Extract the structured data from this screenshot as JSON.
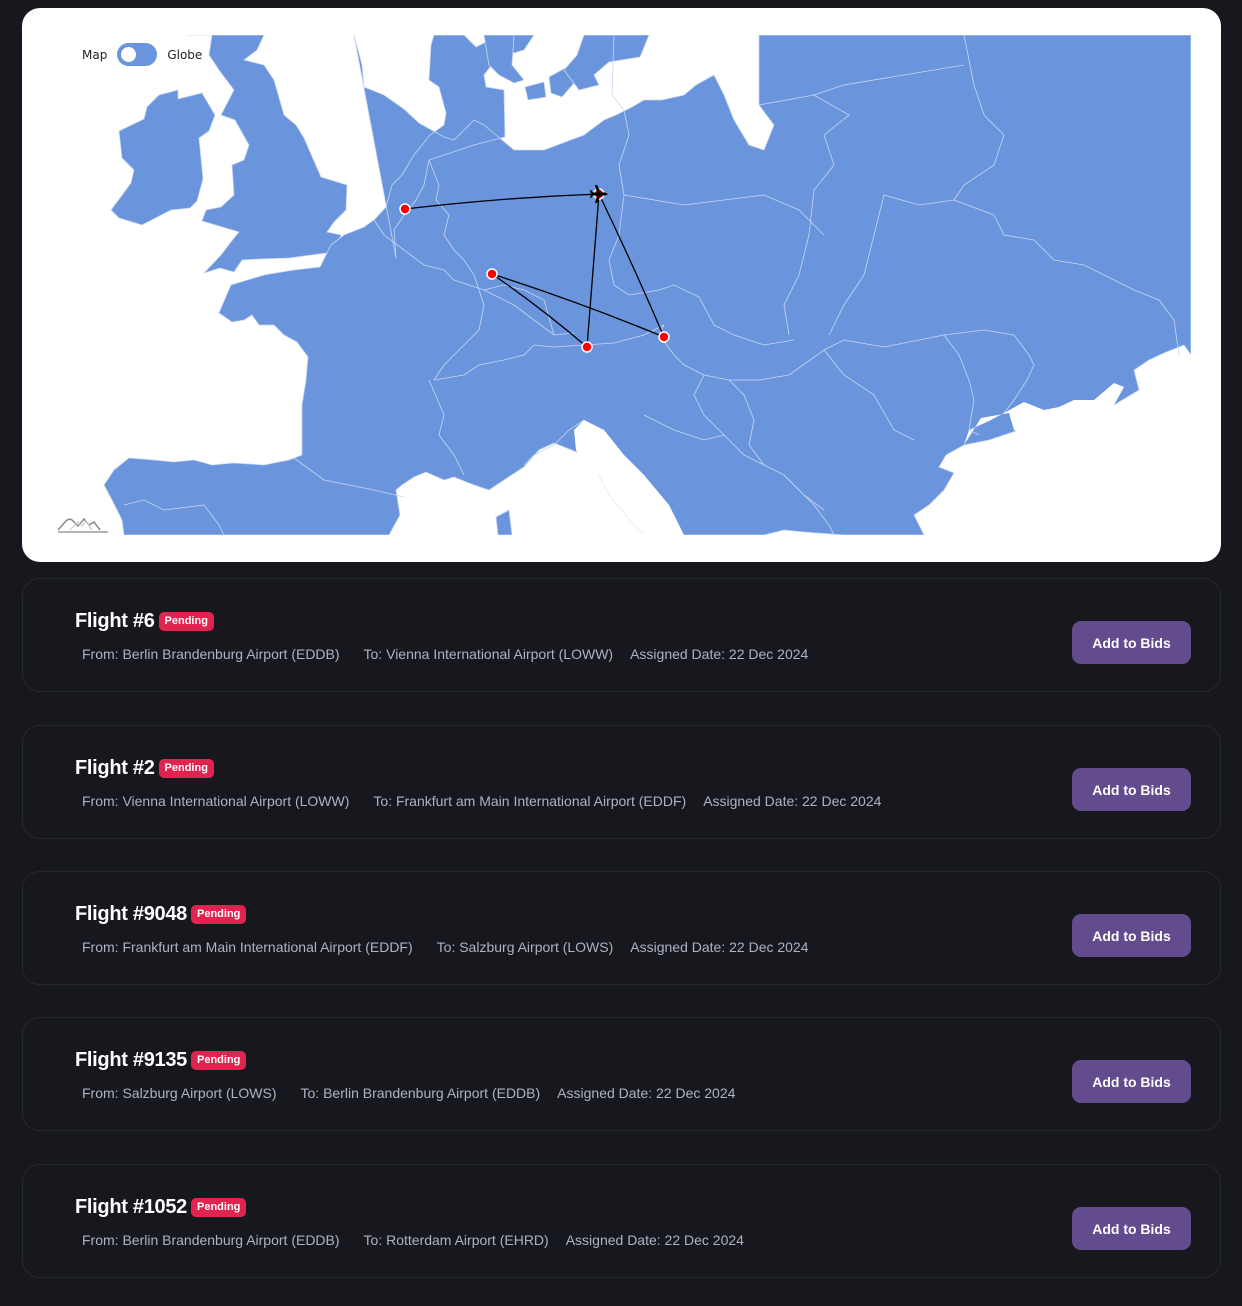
{
  "map": {
    "toggle_left_label": "Map",
    "toggle_right_label": "Globe",
    "toggle_state": "Map",
    "land_color": "#6a95dc",
    "border_color": "#c8d6f2",
    "route_color": "#000000",
    "airport_marker_color": "#ff0000",
    "airports": [
      {
        "code": "EDDB",
        "name": "Berlin Brandenburg Airport"
      },
      {
        "code": "EHRD",
        "name": "Rotterdam Airport"
      },
      {
        "code": "EDDF",
        "name": "Frankfurt am Main International Airport"
      },
      {
        "code": "LOWS",
        "name": "Salzburg Airport"
      },
      {
        "code": "LOWW",
        "name": "Vienna International Airport"
      }
    ],
    "routes": [
      [
        "EDDB",
        "LOWW"
      ],
      [
        "LOWW",
        "EDDF"
      ],
      [
        "EDDF",
        "LOWS"
      ],
      [
        "LOWS",
        "EDDB"
      ],
      [
        "EDDB",
        "EHRD"
      ]
    ],
    "aircraft_at": "EDDB"
  },
  "flights": [
    {
      "title": "Flight #6",
      "status": "Pending",
      "from": "From: Berlin Brandenburg Airport (EDDB)",
      "to": "To: Vienna International Airport (LOWW)",
      "assigned": "Assigned Date: 22 Dec 2024",
      "button": "Add to Bids"
    },
    {
      "title": "Flight #2",
      "status": "Pending",
      "from": "From: Vienna International Airport (LOWW)",
      "to": "To: Frankfurt am Main International Airport (EDDF)",
      "assigned": "Assigned Date: 22 Dec 2024",
      "button": "Add to Bids"
    },
    {
      "title": "Flight #9048",
      "status": "Pending",
      "from": "From: Frankfurt am Main International Airport (EDDF)",
      "to": "To: Salzburg Airport (LOWS)",
      "assigned": "Assigned Date: 22 Dec 2024",
      "button": "Add to Bids"
    },
    {
      "title": "Flight #9135",
      "status": "Pending",
      "from": "From: Salzburg Airport (LOWS)",
      "to": "To: Berlin Brandenburg Airport (EDDB)",
      "assigned": "Assigned Date: 22 Dec 2024",
      "button": "Add to Bids"
    },
    {
      "title": "Flight #1052",
      "status": "Pending",
      "from": "From: Berlin Brandenburg Airport (EDDB)",
      "to": "To: Rotterdam Airport (EHRD)",
      "assigned": "Assigned Date: 22 Dec 2024",
      "button": "Add to Bids"
    }
  ]
}
